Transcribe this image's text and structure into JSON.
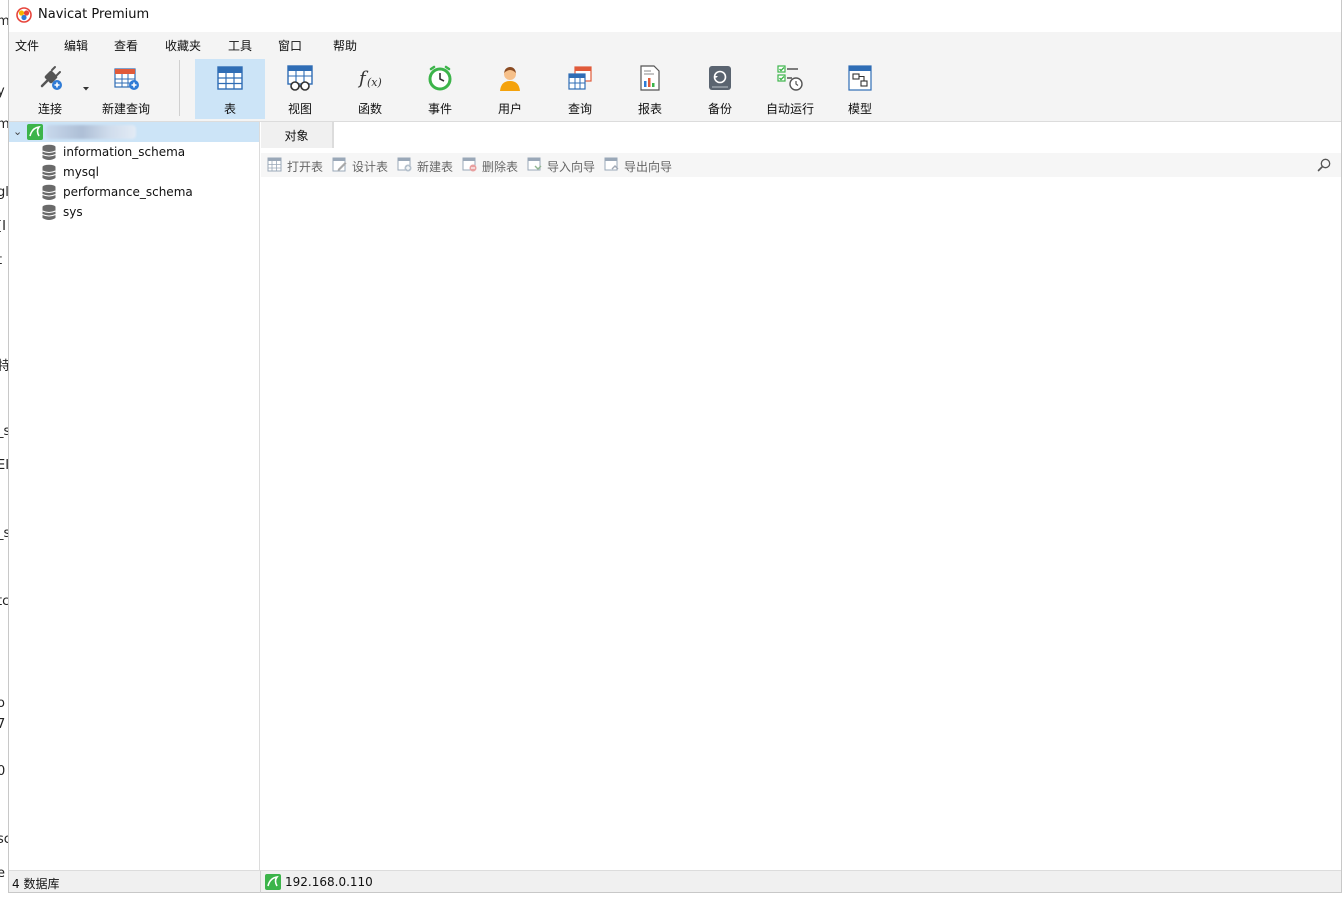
{
  "window": {
    "title": "Navicat Premium"
  },
  "menu": [
    "文件",
    "编辑",
    "查看",
    "收藏夹",
    "工具",
    "窗口",
    "帮助"
  ],
  "toolbar": {
    "connect": "连接",
    "new_query": "新建查询",
    "table": "表",
    "view": "视图",
    "function": "函数",
    "event": "事件",
    "user": "用户",
    "query": "查询",
    "report": "报表",
    "backup": "备份",
    "autorun": "自动运行",
    "model": "模型"
  },
  "sidebar": {
    "databases": [
      "information_schema",
      "mysql",
      "performance_schema",
      "sys"
    ]
  },
  "tabs": {
    "objects": "对象"
  },
  "object_toolbar": {
    "open_table": "打开表",
    "design_table": "设计表",
    "new_table": "新建表",
    "delete_table": "删除表",
    "import_wizard": "导入向导",
    "export_wizard": "导出向导"
  },
  "status": {
    "left": "4 数据库",
    "right": "192.168.0.110"
  },
  "background_window_fragments": [
    "m",
    "y",
    "m",
    "gl",
    "[I",
    "t",
    "特",
    "_s",
    "EI",
    "_s",
    "tc",
    "o",
    "7",
    "0",
    "sc",
    "e"
  ],
  "colors": {
    "active_tool": "#cce4f7",
    "accent_blue": "#2f7bd6",
    "mysql_green": "#3cb44a"
  }
}
